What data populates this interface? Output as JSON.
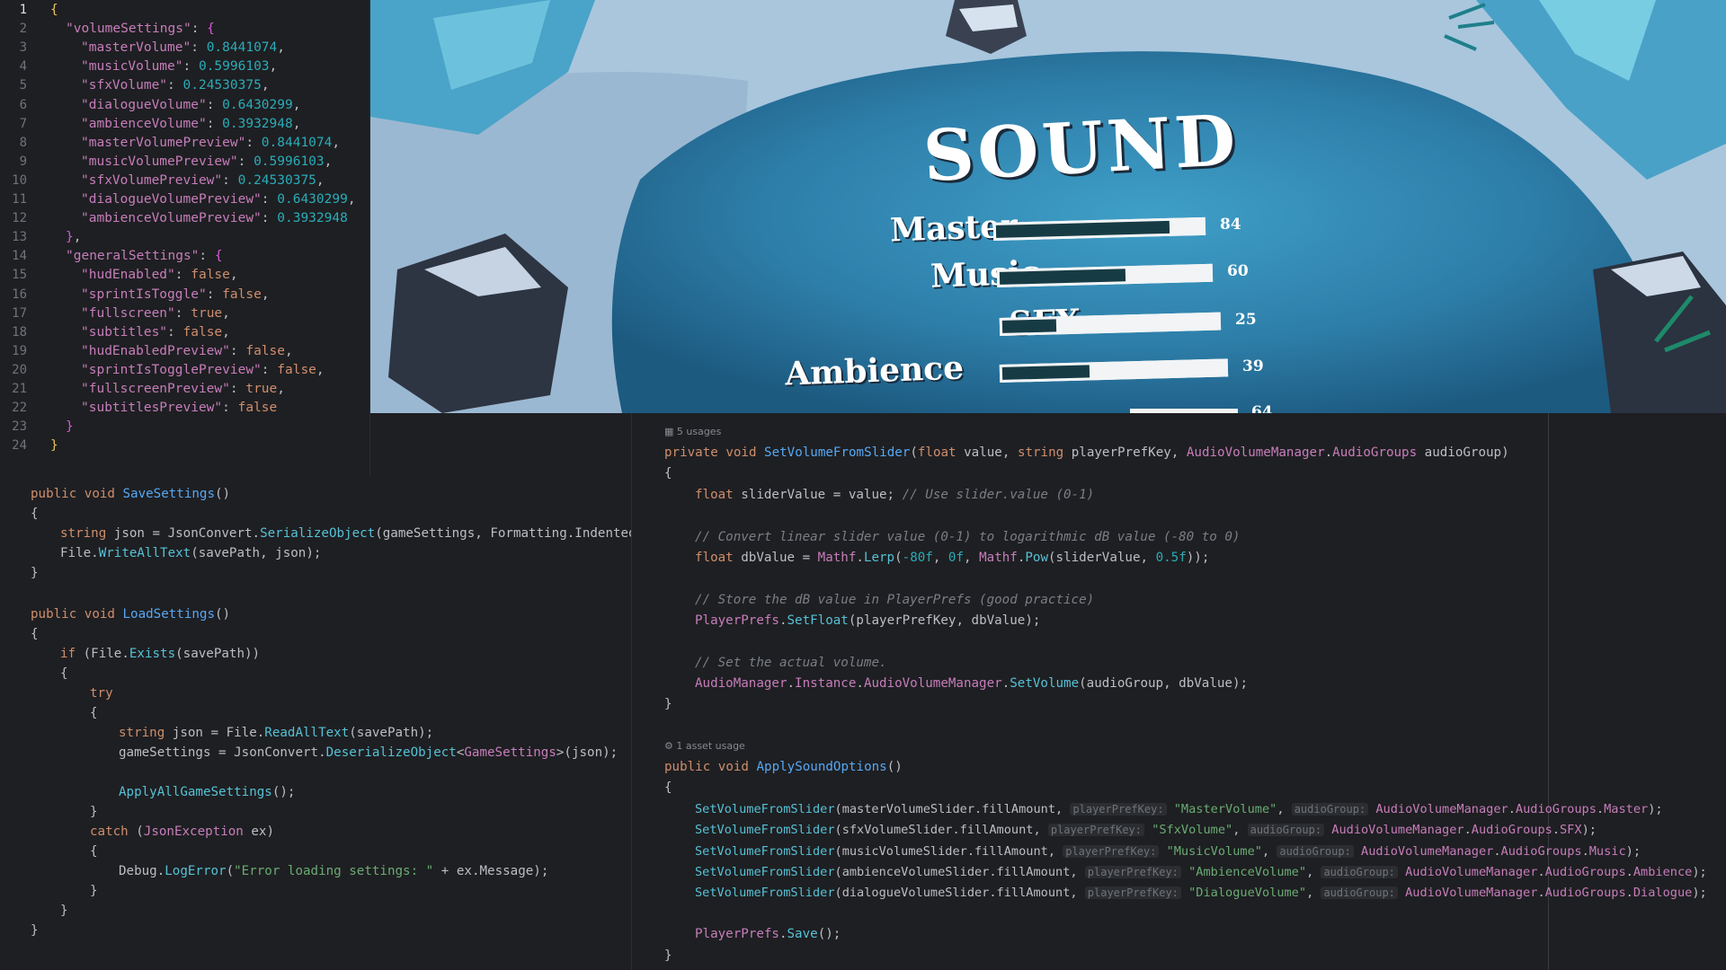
{
  "json_editor": {
    "line_numbers": [
      "1",
      "2",
      "3",
      "4",
      "5",
      "6",
      "7",
      "8",
      "9",
      "10",
      "11",
      "12",
      "13",
      "14",
      "15",
      "16",
      "17",
      "18",
      "19",
      "20",
      "21",
      "22",
      "23",
      "24"
    ],
    "volume_key": "\"volumeSettings\"",
    "general_key": "\"generalSettings\"",
    "volume_entries": [
      {
        "key": "\"masterVolume\"",
        "value": "0.8441074"
      },
      {
        "key": "\"musicVolume\"",
        "value": "0.5996103"
      },
      {
        "key": "\"sfxVolume\"",
        "value": "0.24530375"
      },
      {
        "key": "\"dialogueVolume\"",
        "value": "0.6430299"
      },
      {
        "key": "\"ambienceVolume\"",
        "value": "0.3932948"
      },
      {
        "key": "\"masterVolumePreview\"",
        "value": "0.8441074"
      },
      {
        "key": "\"musicVolumePreview\"",
        "value": "0.5996103"
      },
      {
        "key": "\"sfxVolumePreview\"",
        "value": "0.24530375"
      },
      {
        "key": "\"dialogueVolumePreview\"",
        "value": "0.6430299"
      },
      {
        "key": "\"ambienceVolumePreview\"",
        "value": "0.3932948"
      }
    ],
    "general_entries": [
      {
        "key": "\"hudEnabled\"",
        "value": "false"
      },
      {
        "key": "\"sprintIsToggle\"",
        "value": "false"
      },
      {
        "key": "\"fullscreen\"",
        "value": "true"
      },
      {
        "key": "\"subtitles\"",
        "value": "false"
      },
      {
        "key": "\"hudEnabledPreview\"",
        "value": "false"
      },
      {
        "key": "\"sprintIsTogglePreview\"",
        "value": "false"
      },
      {
        "key": "\"fullscreenPreview\"",
        "value": "true"
      },
      {
        "key": "\"subtitlesPreview\"",
        "value": "false"
      }
    ]
  },
  "game_menu": {
    "title": "SOUND",
    "sliders": [
      {
        "label": "Master",
        "value": "84",
        "fill": 0.84
      },
      {
        "label": "Music",
        "value": "60",
        "fill": 0.6
      },
      {
        "label": "SFX",
        "value": "25",
        "fill": 0.25
      },
      {
        "label": "Ambience",
        "value": "39",
        "fill": 0.39
      }
    ],
    "partial_value": "64"
  },
  "save_load_code": {
    "save_sig": "SaveSettings",
    "serialize": "SerializeObject",
    "write": "WriteAllText",
    "load_sig": "LoadSettings",
    "exists": "Exists",
    "read": "ReadAllText",
    "deserialize": "DeserializeObject",
    "generic": "GameSettings",
    "apply": "ApplyAllGameSettings",
    "exception": "JsonException",
    "logerror": "LogError",
    "error_msg": "\"Error loading settings: \""
  },
  "audio_code": {
    "usage1": "5 usages",
    "usage2": "1 asset usage",
    "method1": "SetVolumeFromSlider",
    "method2": "ApplySoundOptions",
    "comment1": "// Use slider.value (0-1)",
    "comment2": "// Convert linear slider value (0-1) to logarithmic dB value (-80 to 0)",
    "comment3": "// Store the dB value in PlayerPrefs (good practice)",
    "comment4": "// Set the actual volume.",
    "calls": [
      {
        "slider": "masterVolumeSlider",
        "key": "\"MasterVolume\"",
        "group": "Master"
      },
      {
        "slider": "sfxVolumeSlider",
        "key": "\"SfxVolume\"",
        "group": "SFX"
      },
      {
        "slider": "musicVolumeSlider",
        "key": "\"MusicVolume\"",
        "group": "Music"
      },
      {
        "slider": "ambienceVolumeSlider",
        "key": "\"AmbienceVolume\"",
        "group": "Ambience"
      },
      {
        "slider": "dialogueVolumeSlider",
        "key": "\"DialogueVolume\"",
        "group": "Dialogue"
      }
    ]
  }
}
